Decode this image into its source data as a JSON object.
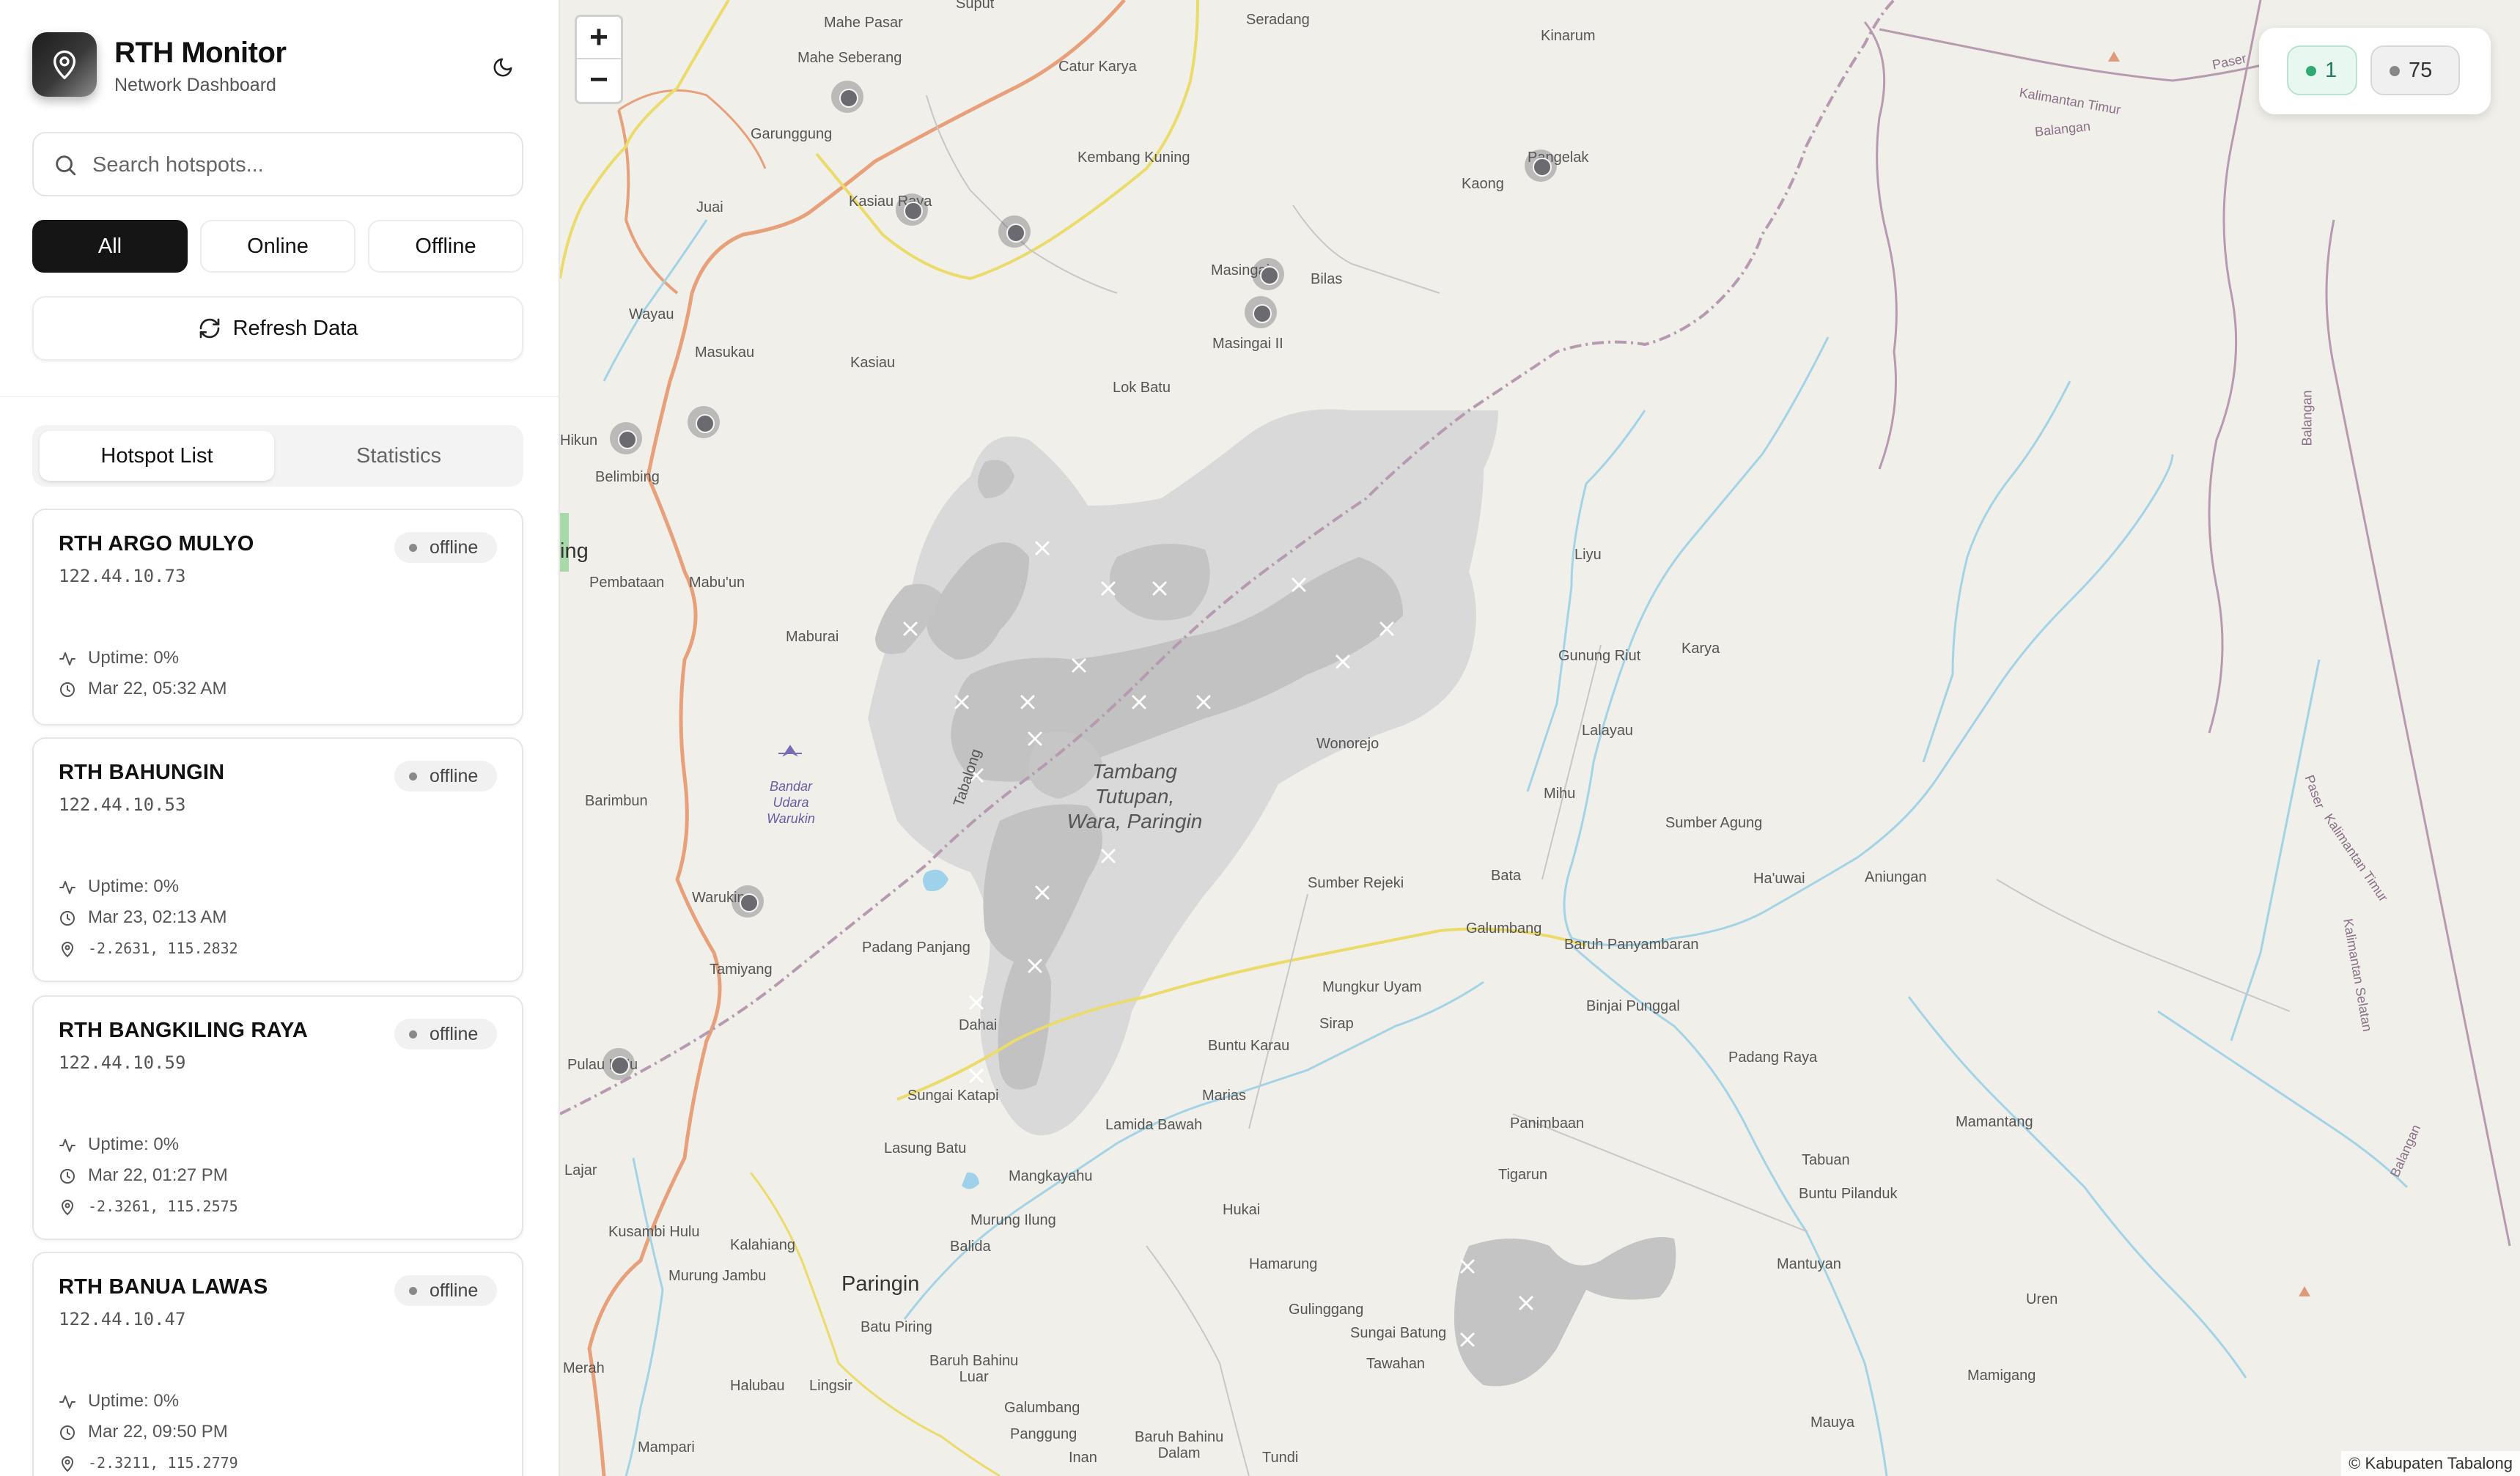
{
  "app": {
    "title": "RTH Monitor",
    "subtitle": "Network Dashboard",
    "icon": "map-pin-icon",
    "theme_icon": "moon-icon"
  },
  "search": {
    "placeholder": "Search hotspots...",
    "value": ""
  },
  "filters": [
    {
      "label": "All",
      "active": true
    },
    {
      "label": "Online",
      "active": false
    },
    {
      "label": "Offline",
      "active": false
    }
  ],
  "refresh_label": "Refresh Data",
  "tabs": [
    {
      "label": "Hotspot List",
      "active": true
    },
    {
      "label": "Statistics",
      "active": false
    }
  ],
  "hotspots": [
    {
      "name": "RTH ARGO MULYO",
      "ip": "122.44.10.73",
      "status": "offline",
      "uptime": "Uptime: 0%",
      "time": "Mar 22, 05:32 AM",
      "coords": ""
    },
    {
      "name": "RTH BAHUNGIN",
      "ip": "122.44.10.53",
      "status": "offline",
      "uptime": "Uptime: 0%",
      "time": "Mar 23, 02:13 AM",
      "coords": "-2.2631, 115.2832"
    },
    {
      "name": "RTH BANGKILING RAYA",
      "ip": "122.44.10.59",
      "status": "offline",
      "uptime": "Uptime: 0%",
      "time": "Mar 22, 01:27 PM",
      "coords": "-2.3261, 115.2575"
    },
    {
      "name": "RTH BANUA LAWAS",
      "ip": "122.44.10.47",
      "status": "offline",
      "uptime": "Uptime: 0%",
      "time": "Mar 22, 09:50 PM",
      "coords": "-2.3211, 115.2779"
    }
  ],
  "map": {
    "zoom_in": "+",
    "zoom_out": "−",
    "online_count": "1",
    "offline_count": "75",
    "online_color": "#2faa74",
    "offline_color": "#888888",
    "attribution": "© Kabupaten Tabalong",
    "labels": {
      "mahe_pasar": "Mahe Pasar",
      "suput": "Suput",
      "seradang": "Seradang",
      "kinarum": "Kinarum",
      "mahe_seberang": "Mahe Seberang",
      "catur_karya": "Catur Karya",
      "garunggung": "Garunggung",
      "kembang_kuning": "Kembang Kuning",
      "kaong": "Kaong",
      "pangelak": "Pangelak",
      "juai": "Juai",
      "kasiau_raya": "Kasiau Raya",
      "masingai": "Masingai",
      "bilas": "Bilas",
      "masingai_ii": "Masingai II",
      "wayau": "Wayau",
      "masukau": "Masukau",
      "kasiau": "Kasiau",
      "lok_batu": "Lok Batu",
      "hikun": "Hikun",
      "belimbing": "Belimbing",
      "ing": "ing",
      "pembataan": "Pembataan",
      "mabuun": "Mabu'un",
      "maburai": "Maburai",
      "liyu": "Liyu",
      "gunung_riut": "Gunung Riut",
      "karya": "Karya",
      "lalayau": "Lalayau",
      "mine_area": "Tambang\nTutupan,\nWara, Paringin",
      "wonorejo": "Wonorejo",
      "airport": "Bandar\nUdara\nWarukin",
      "barimbun": "Barimbun",
      "mihu": "Mihu",
      "sumber_agung": "Sumber Agung",
      "tabalong": "Tabalong",
      "sumber_rejeki": "Sumber Rejeki",
      "bata": "Bata",
      "hauwai": "Ha'uwai",
      "aniungan": "Aniungan",
      "warukin": "Warukin",
      "padang_panjang": "Padang Panjang",
      "galumbang": "Galumbang",
      "baruh_panyambaran": "Baruh Panyambaran",
      "tamiyang": "Tamiyang",
      "mungkur_uyam": "Mungkur Uyam",
      "binjai_punggal": "Binjai Punggal",
      "sirap": "Sirap",
      "dahai": "Dahai",
      "buntu_karau": "Buntu Karau",
      "padang_raya": "Padang Raya",
      "pulau_kuu": "Pulau Ku'u",
      "sungai_katapi": "Sungai Katapi",
      "marias": "Marias",
      "panimbaan": "Panimbaan",
      "lamida_bawah": "Lamida Bawah",
      "mamantang": "Mamantang",
      "lasung_batu": "Lasung Batu",
      "tabuan": "Tabuan",
      "lajar": "Lajar",
      "mangkayahu": "Mangkayahu",
      "tigarun": "Tigarun",
      "buntu_pilanduk": "Buntu Pilanduk",
      "murung_ilung": "Murung Ilung",
      "hukai": "Hukai",
      "kusambi_hulu": "Kusambi Hulu",
      "kalahiang": "Kalahiang",
      "balida": "Balida",
      "murung_jambu": "Murung Jambu",
      "paringin": "Paringin",
      "hamarung": "Hamarung",
      "mantuyan": "Mantuyan",
      "uren": "Uren",
      "batu_piring": "Batu Piring",
      "gulinggang": "Gulinggang",
      "sungai_batung": "Sungai Batung",
      "merah": "Merah",
      "halubau": "Halubau",
      "lingsir": "Lingsir",
      "baruh_bahinu_luar": "Baruh Bahinu\nLuar",
      "tawahan": "Tawahan",
      "mamigang": "Mamigang",
      "galumbang2": "Galumbang",
      "panggung": "Panggung",
      "mauya": "Mauya",
      "mampari": "Mampari",
      "inan": "Inan",
      "baruh_bahinu_dalam": "Baruh Bahinu\nDalam",
      "tundi": "Tundi",
      "kaltim_balangan": "Kalimantan Timur",
      "balangan_top": "Balangan",
      "paser_top": "Paser",
      "balangan_right": "Balangan",
      "paser_right": "Paser",
      "kaltim_right": "Kalimantan Timur",
      "kalsel_right": "Kalimantan Selatan",
      "balangan_br": "Balangan"
    }
  }
}
